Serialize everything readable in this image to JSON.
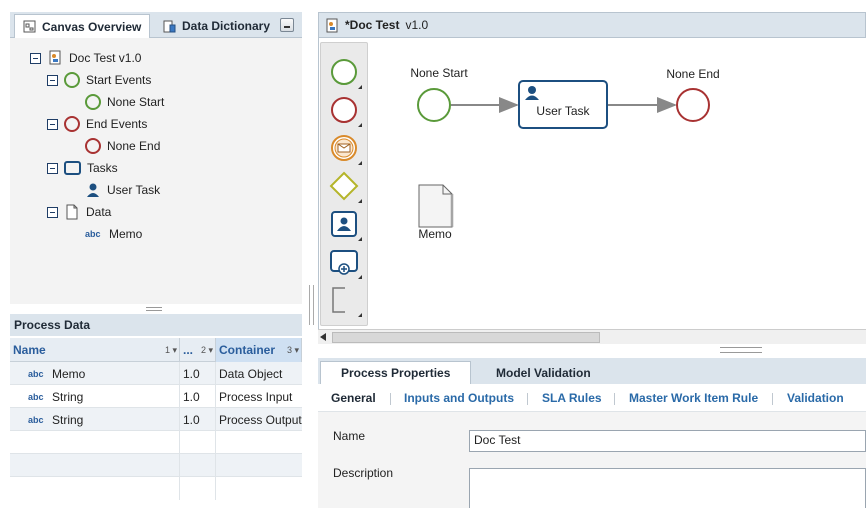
{
  "left_tabs": {
    "canvas_overview": "Canvas Overview",
    "data_dictionary": "Data Dictionary"
  },
  "tree": {
    "root": "Doc Test  v1.0",
    "start_events": "Start Events",
    "none_start": "None Start",
    "end_events": "End Events",
    "none_end": "None End",
    "tasks": "Tasks",
    "user_task": "User Task",
    "data": "Data",
    "memo_abc": "abc",
    "memo": "Memo"
  },
  "process_data": {
    "title": "Process Data",
    "columns": [
      {
        "label": "Name",
        "sort": "1 ▾"
      },
      {
        "label": "...",
        "sort": "2 ▾"
      },
      {
        "label": "Container",
        "sort": "3 ▾"
      }
    ],
    "rows": [
      {
        "type": "abc",
        "name": "Memo",
        "version": "1.0",
        "container": "Data Object"
      },
      {
        "type": "abc",
        "name": "String",
        "version": "1.0",
        "container": "Process Input"
      },
      {
        "type": "abc",
        "name": "String",
        "version": "1.0",
        "container": "Process Output"
      }
    ]
  },
  "canvas": {
    "title": "*Doc Test",
    "version": "v1.0",
    "none_start_label": "None Start",
    "user_task_label": "User Task",
    "none_end_label": "None End",
    "memo_label": "Memo"
  },
  "palette": [
    "start-event",
    "end-event",
    "message-event",
    "gateway",
    "user-task",
    "subprocess",
    "annotation"
  ],
  "properties": {
    "tabs": {
      "process_properties": "Process Properties",
      "model_validation": "Model Validation"
    },
    "subtabs": {
      "general": "General",
      "inputs_outputs": "Inputs and Outputs",
      "sla_rules": "SLA Rules",
      "master_work_item_rule": "Master Work Item Rule",
      "validation": "Validation"
    },
    "name_label": "Name",
    "name_value": "Doc Test",
    "description_label": "Description",
    "description_value": ""
  },
  "colors": {
    "start": "#5a9a3a",
    "end": "#a83232",
    "task": "#1c4f80",
    "message": "#d98a2b",
    "gateway": "#b5b52a"
  }
}
